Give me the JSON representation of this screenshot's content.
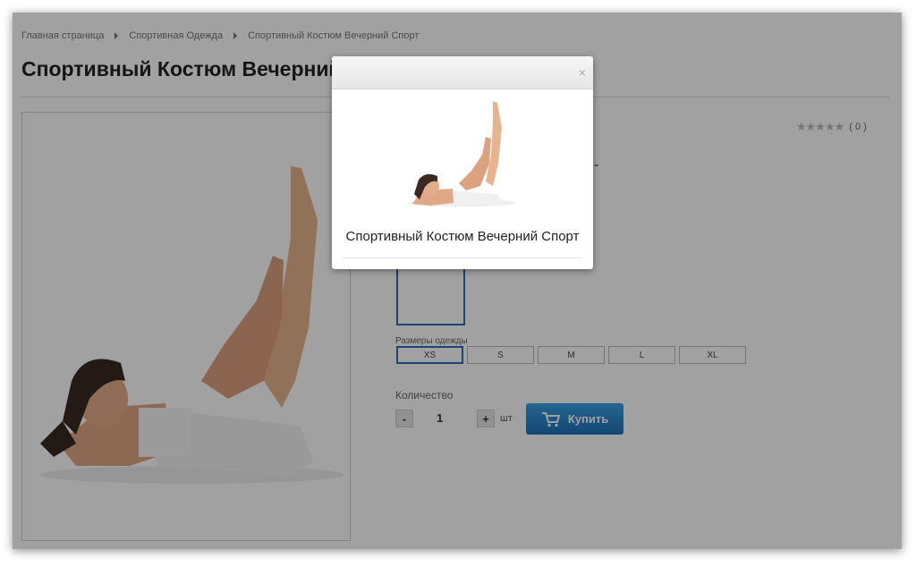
{
  "breadcrumb": [
    "Главная страница",
    "Спортивная Одежда",
    "Спортивный Костюм Вечерний Спорт"
  ],
  "product": {
    "title": "Спортивный Костюм Вечерний Спорт",
    "rating_count": "( 0 )",
    "stars": "★★★★★"
  },
  "options": {
    "sizes_label": "Размеры одежды",
    "sizes": [
      "XS",
      "S",
      "M",
      "L",
      "XL"
    ],
    "selected_size": "XS"
  },
  "quantity": {
    "label": "Количество",
    "minus": "-",
    "value": "1",
    "plus": "+",
    "unit": "шт"
  },
  "buy_button": {
    "label": "Купить",
    "color": "#2a86d0"
  },
  "modal": {
    "close": "×",
    "caption": "Спортивный Костюм Вечерний Спорт"
  },
  "colors": {
    "accent": "#2a6fb8",
    "overlay": "rgba(0,0,0,0.37)"
  }
}
